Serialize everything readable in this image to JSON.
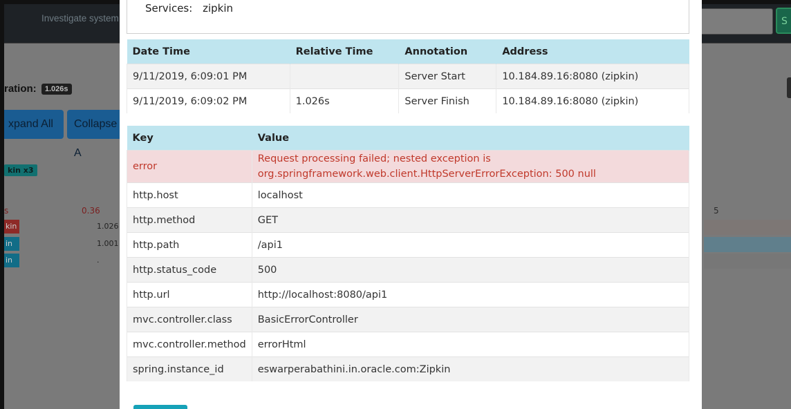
{
  "background": {
    "nav_title": "Investigate system",
    "nav_button_label": "S",
    "duration_label": "ration:",
    "duration_value": "1.026s",
    "expand_label": "xpand All",
    "collapse_label": "Collapse A",
    "service_badge": "kin x3",
    "tick_left": "s",
    "tick_value": "0.36",
    "tick_right": "5",
    "rows": [
      {
        "label": "kin",
        "duration": "1.026",
        "color": "#8e2a27"
      },
      {
        "label": "in",
        "duration": "1.001",
        "color": "#126d87"
      },
      {
        "label": "in",
        "duration": ".",
        "color": "#126d87"
      }
    ]
  },
  "modal": {
    "services_label": "Services:",
    "services_value": "zipkin",
    "annotations": {
      "headers": [
        "Date Time",
        "Relative Time",
        "Annotation",
        "Address"
      ],
      "rows": [
        [
          "9/11/2019, 6:09:01 PM",
          "",
          "Server Start",
          "10.184.89.16:8080 (zipkin)"
        ],
        [
          "9/11/2019, 6:09:02 PM",
          "1.026s",
          "Server Finish",
          "10.184.89.16:8080 (zipkin)"
        ]
      ]
    },
    "tags": {
      "headers": [
        "Key",
        "Value"
      ],
      "rows": [
        [
          "error",
          "Request processing failed; nested exception is org.springframework.web.client.HttpServerErrorException: 500 null"
        ],
        [
          "http.host",
          "localhost"
        ],
        [
          "http.method",
          "GET"
        ],
        [
          "http.path",
          "/api1"
        ],
        [
          "http.status_code",
          "500"
        ],
        [
          "http.url",
          "http://localhost:8080/api1"
        ],
        [
          "mvc.controller.class",
          "BasicErrorController"
        ],
        [
          "mvc.controller.method",
          "errorHtml"
        ],
        [
          "spring.instance_id",
          "eswarperabathini.in.oracle.com:Zipkin"
        ]
      ]
    }
  },
  "colors": {
    "table_header": "#bfe5ef",
    "error_row_bg": "#f3dadc",
    "error_text": "#c0392b",
    "primary_button": "#1a5c92",
    "info_button": "#17a2b8"
  }
}
